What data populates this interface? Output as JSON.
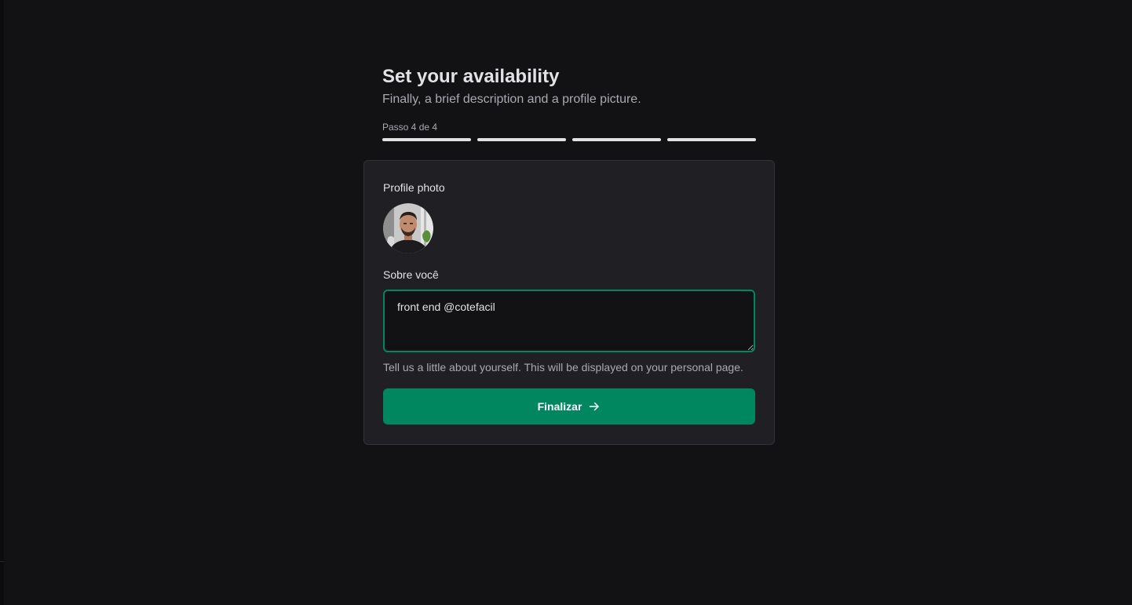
{
  "header": {
    "title": "Set your availability",
    "subtitle": "Finally, a brief description and a profile picture.",
    "step_label": "Passo 4 de 4",
    "steps_total": 4,
    "steps_completed": 4
  },
  "form": {
    "photo_label": "Profile photo",
    "about_label": "Sobre você",
    "about_value": "front end @cotefacil",
    "about_help": "Tell us a little about yourself. This will be displayed on your personal page.",
    "submit_label": "Finalizar",
    "submit_icon": "arrow-right-icon"
  },
  "colors": {
    "background": "#121214",
    "card": "#202024",
    "accent": "#00875f",
    "text": "#e1e1e6",
    "muted_text": "#a9a9b2"
  }
}
